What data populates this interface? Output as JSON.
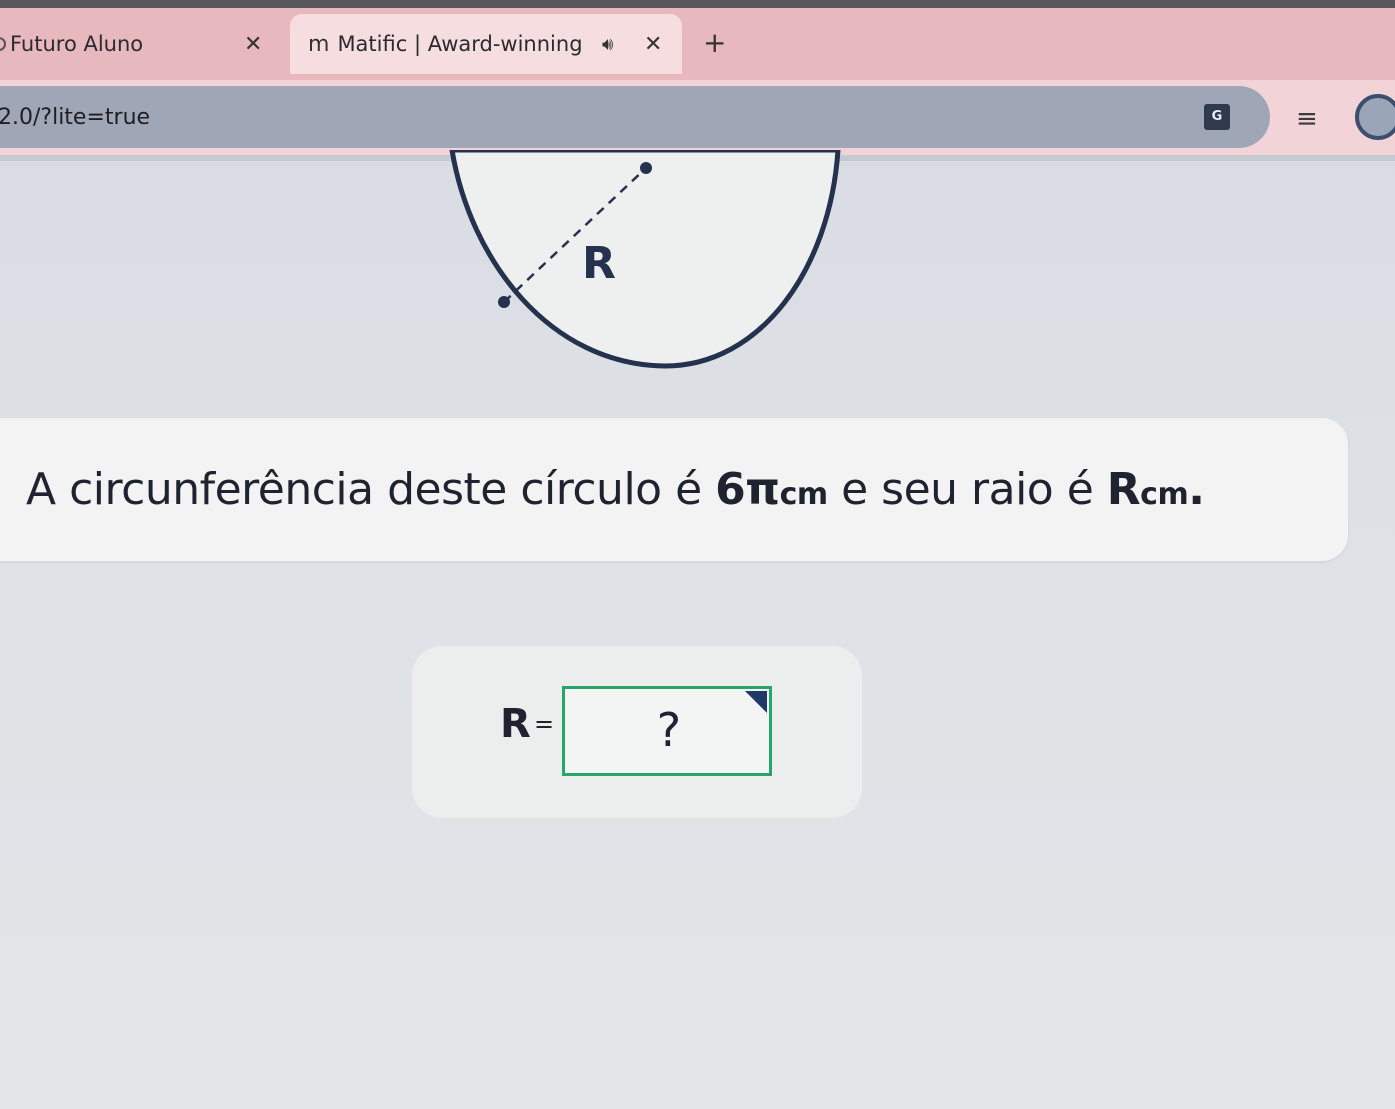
{
  "browser": {
    "tabs": [
      {
        "title": "Futuro Aluno",
        "icon": "page-icon",
        "active": false
      },
      {
        "title": "Matific | Award-winning lea",
        "icon": "matific-logo",
        "active": true
      }
    ],
    "audio_icon": "speaker-icon",
    "close_glyph": "✕",
    "new_tab_glyph": "+",
    "url": "2.0/?lite=true",
    "translate_label": "G"
  },
  "figure": {
    "radius_label": "R"
  },
  "question": {
    "text_before": "A circunferência deste círculo é ",
    "value": "6π",
    "unit_1": "cm",
    "text_middle": " e seu raio é ",
    "variable": "R",
    "unit_2": "cm",
    "end": "."
  },
  "answer": {
    "variable": "R",
    "equals": "=",
    "placeholder": "?"
  },
  "colors": {
    "tab_strip": "#e7b8bd",
    "omnibox": "#9fa7b7",
    "answer_border": "#27a56a",
    "text": "#1f2330"
  }
}
